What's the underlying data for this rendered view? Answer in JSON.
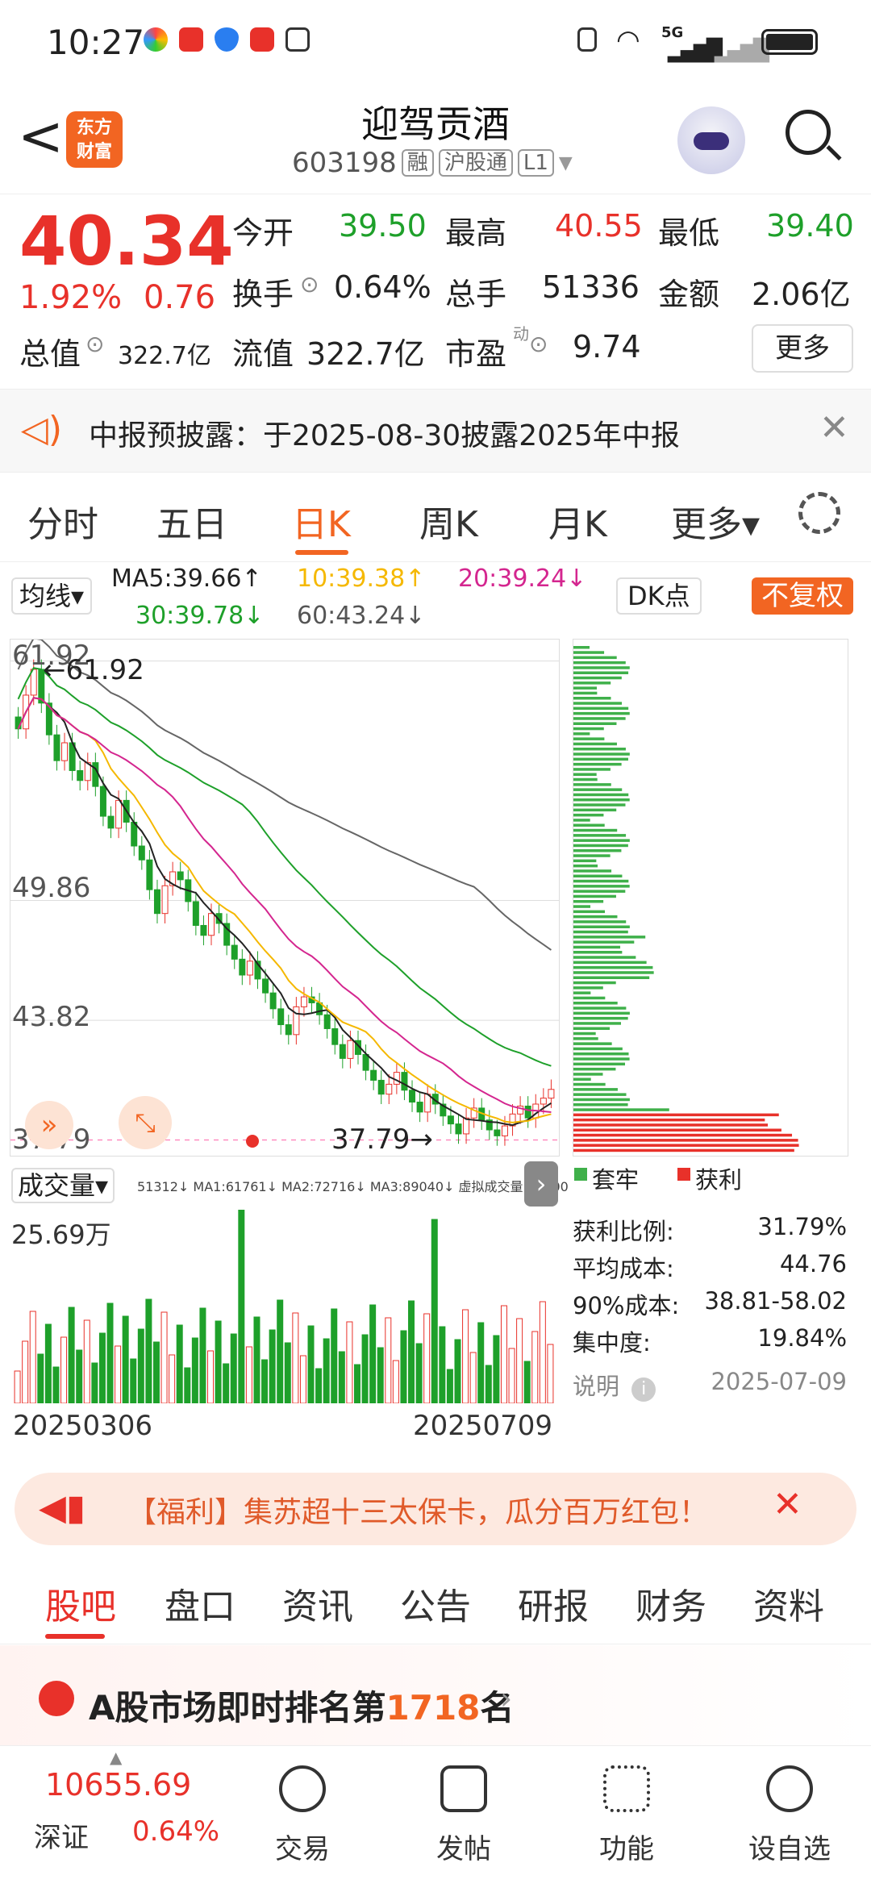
{
  "status": {
    "time": "10:27",
    "network": "5G"
  },
  "header": {
    "back": "<",
    "logo_line1": "东方",
    "logo_line2": "财富",
    "title": "迎驾贡酒",
    "code": "603198",
    "tags": [
      "融",
      "沪股通",
      "L1"
    ]
  },
  "quote": {
    "price": "40.34",
    "change_pct": "1.92%",
    "change": "0.76",
    "open_label": "今开",
    "open": "39.50",
    "high_label": "最高",
    "high": "40.55",
    "low_label": "最低",
    "low": "39.40",
    "turnover_label": "换手",
    "turnover": "0.64%",
    "volume_label": "总手",
    "volume": "51336",
    "amount_label": "金额",
    "amount": "2.06亿",
    "mktcap_label": "总值",
    "mktcap": "322.7亿",
    "float_label": "流值",
    "float": "322.7亿",
    "pe_label": "市盈",
    "pe_sup": "动",
    "pe": "9.74",
    "more": "更多"
  },
  "notice": {
    "text": "中报预披露：于2025-08-30披露2025年中报"
  },
  "ktabs": [
    "分时",
    "五日",
    "日K",
    "周K",
    "月K",
    "更多▾"
  ],
  "ma": {
    "button": "均线▾",
    "ma5": "MA5:39.66↑",
    "ma10": "10:39.38↑",
    "ma20": "20:39.24↓",
    "ma30": "30:39.78↓",
    "ma60": "60:43.24↓",
    "dk": "DK点",
    "fq": "不复权"
  },
  "chart_data": {
    "type": "candlestick",
    "y_ticks": [
      "61.92",
      "49.86",
      "43.82",
      "37.79"
    ],
    "max_label": "←61.92",
    "min_label": "37.79→",
    "x_start": "20250306",
    "x_end": "20250709",
    "colors": {
      "up": "#e8312a",
      "down": "#1ea02a",
      "ma5": "#222222",
      "ma10": "#f5b800",
      "ma20": "#d4268f",
      "ma30": "#1ea02a",
      "ma60": "#666666"
    },
    "close": [
      58.5,
      60.2,
      61.5,
      59.8,
      58.2,
      56.9,
      57.8,
      56.4,
      55.9,
      56.8,
      55.6,
      54.1,
      53.5,
      54.9,
      53.8,
      52.6,
      51.9,
      50.4,
      49.2,
      50.6,
      51.3,
      50.9,
      49.8,
      48.6,
      48.1,
      49.2,
      48.7,
      47.6,
      46.9,
      46.1,
      46.8,
      45.9,
      45.2,
      44.4,
      43.6,
      43.1,
      44.5,
      45.0,
      44.7,
      44.1,
      43.4,
      42.6,
      41.9,
      42.8,
      42.1,
      41.3,
      40.8,
      40.1,
      40.6,
      41.2,
      40.3,
      39.7,
      39.2,
      40.1,
      39.6,
      39.0,
      38.6,
      38.1,
      38.9,
      39.4,
      38.8,
      38.3,
      38.0,
      38.5,
      39.1,
      39.5,
      38.9,
      39.6,
      39.9,
      40.34
    ]
  },
  "volume": {
    "label": "成交量▾",
    "line": "51312↓ MA1:61761↓ MA2:72716↓ MA3:89040↓ 虚拟成交量:93600",
    "max": "25.69万"
  },
  "chip": {
    "legend_trap": "套牢",
    "legend_profit": "获利",
    "rows": [
      {
        "k": "获利比例:",
        "v": "31.79%"
      },
      {
        "k": "平均成本:",
        "v": "44.76"
      },
      {
        "k": "90%成本:",
        "v": "38.81-58.02"
      },
      {
        "k": "集中度:",
        "v": "19.84%"
      }
    ],
    "note": "说明",
    "date": "2025-07-09"
  },
  "promo": {
    "text": "【福利】集苏超十三太保卡，瓜分百万红包！"
  },
  "btabs": [
    "股吧",
    "盘口",
    "资讯",
    "公告",
    "研报",
    "财务",
    "资料"
  ],
  "rank": {
    "prefix": "A股市场即时排名第",
    "num": "1718",
    "suffix": "名"
  },
  "bottomnav": {
    "index_value": "10655.69",
    "index_name": "深证",
    "index_pct": "0.64%",
    "items": [
      "交易",
      "发帖",
      "功能",
      "设自选"
    ]
  }
}
